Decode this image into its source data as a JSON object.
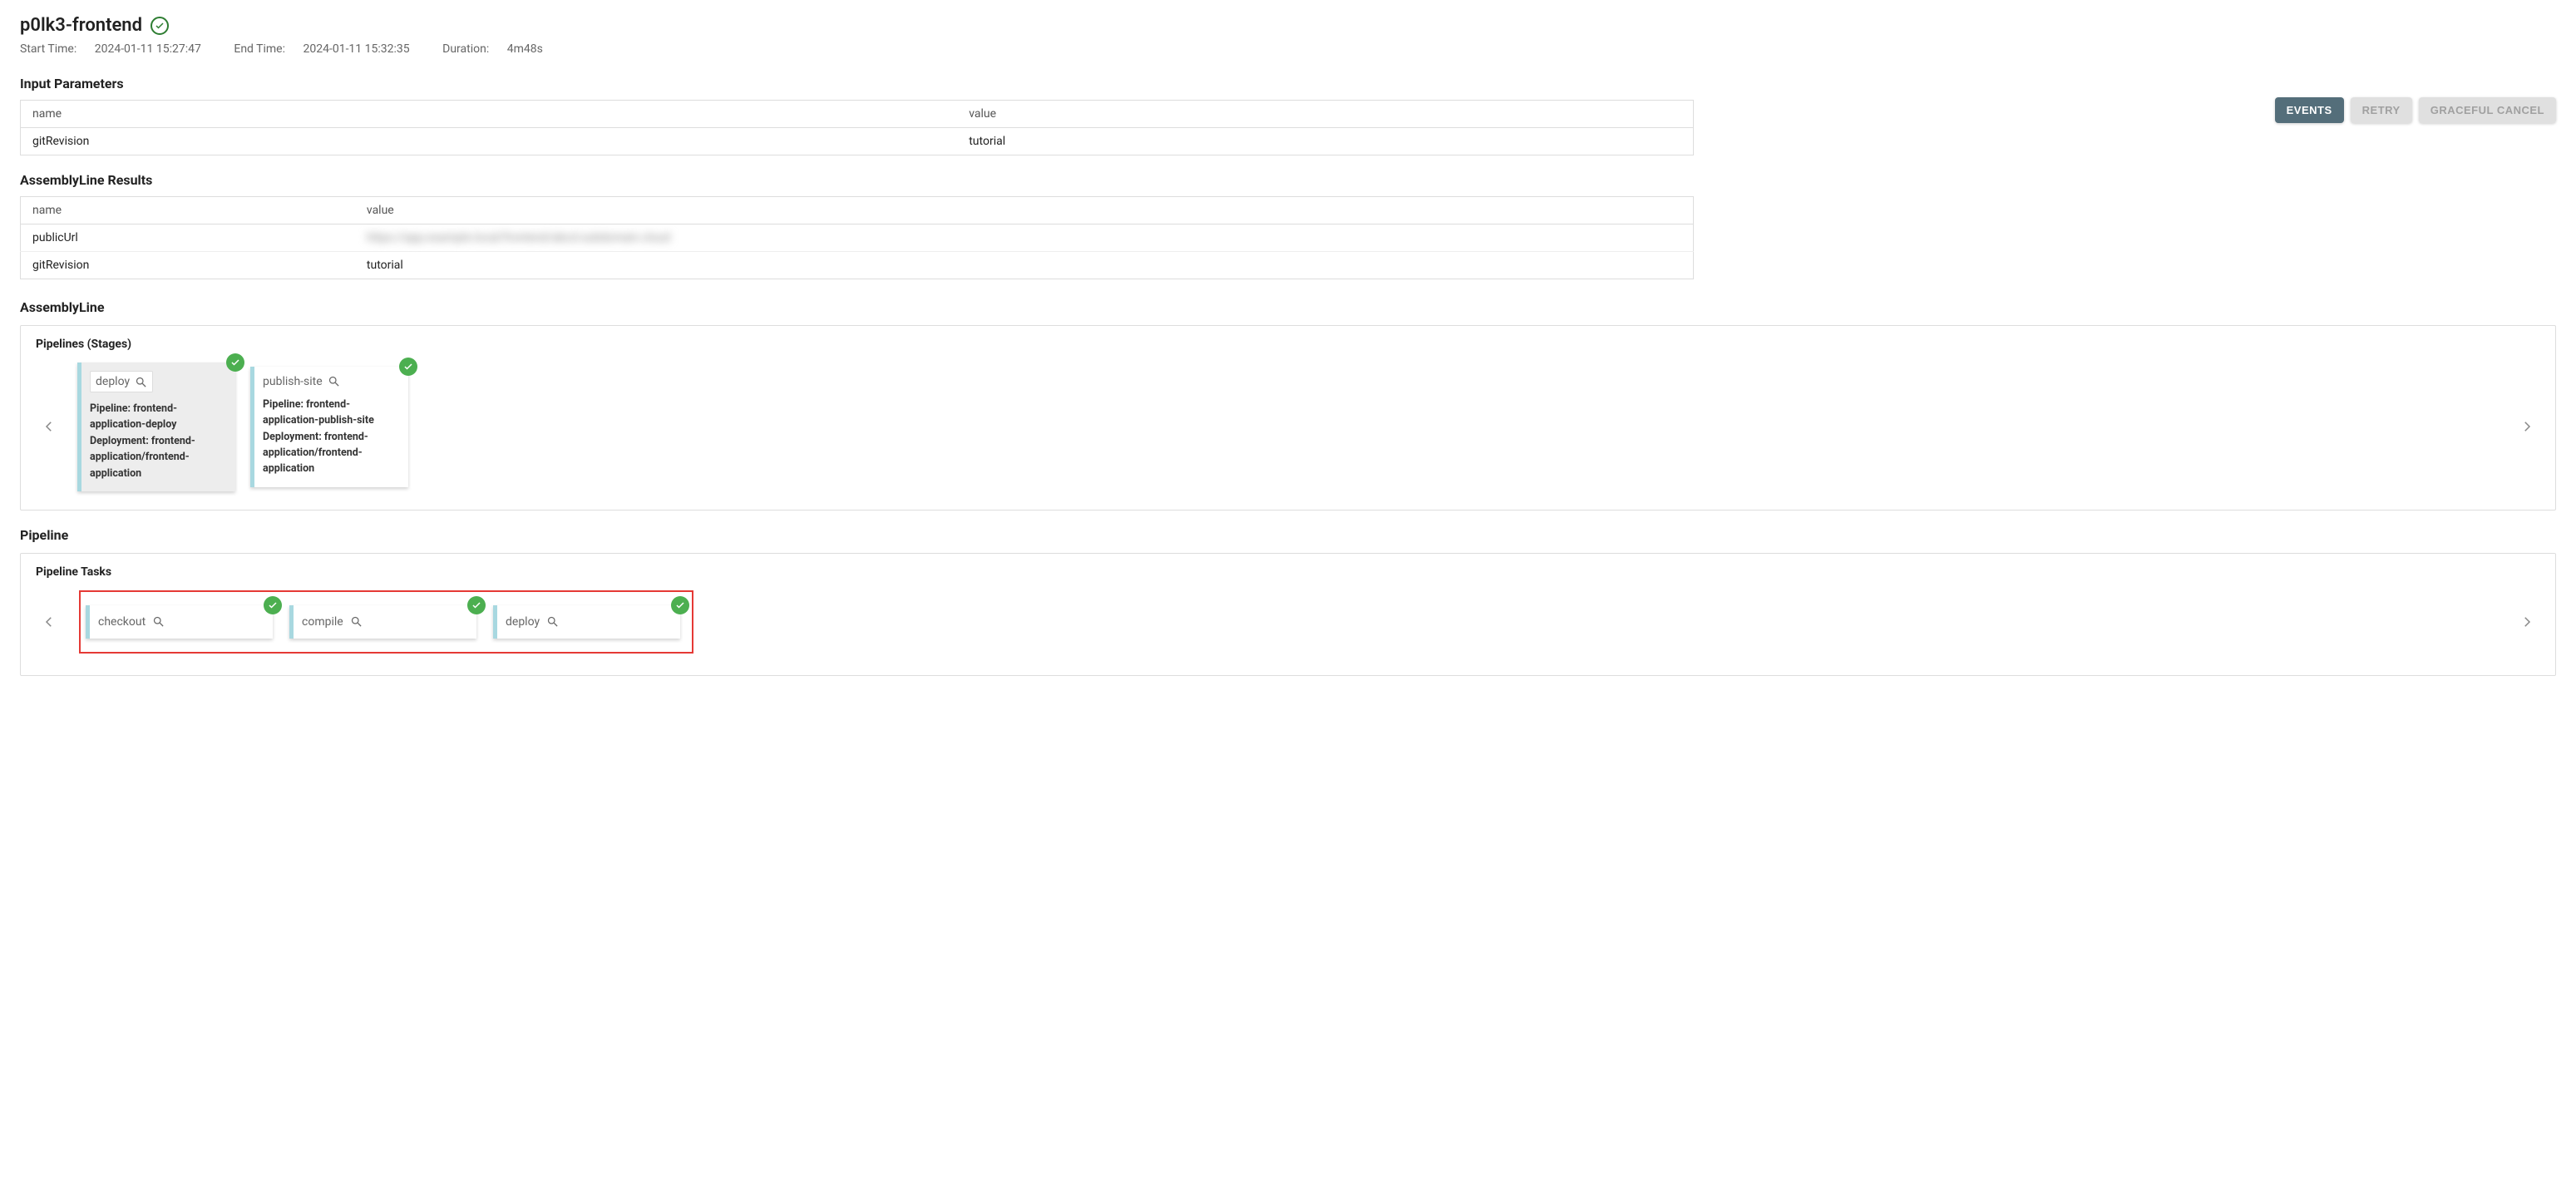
{
  "header": {
    "title": "p0lk3-frontend",
    "start_label": "Start Time:",
    "start_value": "2024-01-11 15:27:47",
    "end_label": "End Time:",
    "end_value": "2024-01-11 15:32:35",
    "duration_label": "Duration:",
    "duration_value": "4m48s"
  },
  "buttons": {
    "events": "EVENTS",
    "retry": "RETRY",
    "cancel": "GRACEFUL CANCEL"
  },
  "input_params": {
    "title": "Input Parameters",
    "col_name": "name",
    "col_value": "value",
    "rows": [
      {
        "name": "gitRevision",
        "value": "tutorial"
      }
    ]
  },
  "results": {
    "title": "AssemblyLine Results",
    "col_name": "name",
    "col_value": "value",
    "rows": [
      {
        "name": "publicUrl",
        "value": "https://app.example.local/frontend/abcd.subdomain.cloud"
      },
      {
        "name": "gitRevision",
        "value": "tutorial"
      }
    ]
  },
  "assemblyline": {
    "title": "AssemblyLine",
    "panel_title": "Pipelines (Stages)",
    "stages": [
      {
        "name": "deploy",
        "pipeline_label": "Pipeline:",
        "pipeline_value": "frontend-application-deploy",
        "deployment_label": "Deployment:",
        "deployment_value": "frontend-application/frontend-application",
        "selected": true
      },
      {
        "name": "publish-site",
        "pipeline_label": "Pipeline:",
        "pipeline_value": "frontend-application-publish-site",
        "deployment_label": "Deployment:",
        "deployment_value": "frontend-application/frontend-application",
        "selected": false
      }
    ]
  },
  "pipeline": {
    "title": "Pipeline",
    "panel_title": "Pipeline Tasks",
    "tasks": [
      {
        "name": "checkout"
      },
      {
        "name": "compile"
      },
      {
        "name": "deploy"
      }
    ]
  }
}
